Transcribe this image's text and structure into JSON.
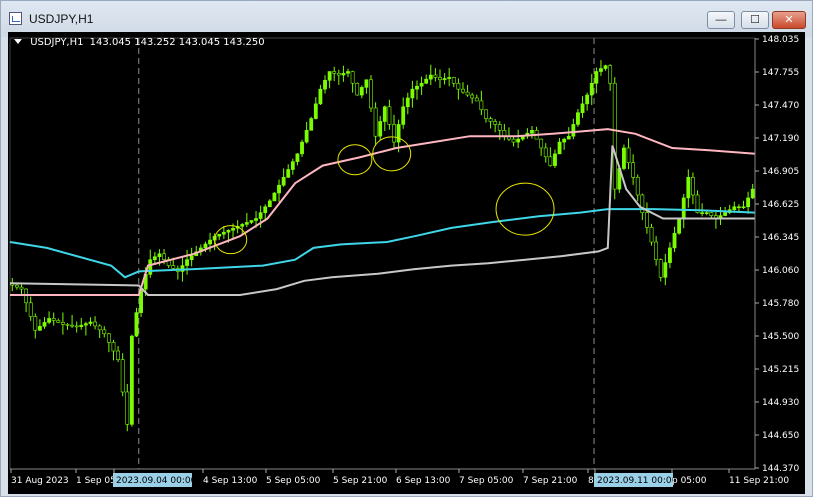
{
  "window": {
    "title": "USDJPY,H1",
    "buttons": {
      "minimize": "—",
      "maximize": "☐",
      "close": "✕"
    }
  },
  "chart_header": {
    "symbol": "USDJPY,H1",
    "ohlc": "143.045 143.252 143.045 143.250"
  },
  "colors": {
    "background": "#000000",
    "candle": "#7CFC00",
    "vwap_cyan": "#3fd6e8",
    "band_pink": "#ffb6c1",
    "band_gray": "#c8c8c8",
    "circles": "#e6e600",
    "period_separator": "#8c8c8c",
    "highlight_label": "#9ad0e8"
  },
  "chart_data": {
    "type": "candlestick",
    "symbol": "USDJPY",
    "timeframe": "H1",
    "y_ticks": [
      "148.035",
      "147.755",
      "147.470",
      "147.190",
      "146.905",
      "146.625",
      "146.345",
      "146.060",
      "145.780",
      "145.500",
      "145.215",
      "144.930",
      "144.650",
      "144.370"
    ],
    "x_labels": [
      "31 Aug 2023",
      "1 Sep 05",
      "2023.09.04 00:00",
      "4 Sep 13:00",
      "5 Sep 05:00",
      "5 Sep 21:00",
      "6 Sep 13:00",
      "7 Sep 05:00",
      "7 Sep 21:00",
      "8",
      "2023.09.11 00:00",
      "p 05:00",
      "11 Sep 21:00"
    ],
    "highlighted_x_labels": [
      "2023.09.04 00:00",
      "2023.09.11 00:00"
    ],
    "ylim": [
      144.37,
      148.035
    ],
    "price_path": [
      [
        0,
        145.95
      ],
      [
        3,
        145.9
      ],
      [
        6,
        145.55
      ],
      [
        9,
        145.65
      ],
      [
        12,
        145.6
      ],
      [
        15,
        145.58
      ],
      [
        18,
        145.62
      ],
      [
        21,
        145.52
      ],
      [
        24,
        145.3
      ],
      [
        26,
        144.75
      ],
      [
        27,
        145.5
      ],
      [
        29,
        145.9
      ],
      [
        31,
        146.15
      ],
      [
        33,
        146.2
      ],
      [
        35,
        146.1
      ],
      [
        37,
        146.05
      ],
      [
        39,
        146.15
      ],
      [
        42,
        146.25
      ],
      [
        45,
        146.35
      ],
      [
        48,
        146.4
      ],
      [
        51,
        146.45
      ],
      [
        54,
        146.5
      ],
      [
        57,
        146.65
      ],
      [
        60,
        146.85
      ],
      [
        63,
        147.05
      ],
      [
        66,
        147.35
      ],
      [
        68,
        147.6
      ],
      [
        70,
        147.75
      ],
      [
        72,
        147.72
      ],
      [
        74,
        147.75
      ],
      [
        76,
        147.55
      ],
      [
        78,
        147.68
      ],
      [
        80,
        147.2
      ],
      [
        82,
        147.45
      ],
      [
        84,
        147.15
      ],
      [
        86,
        147.45
      ],
      [
        88,
        147.6
      ],
      [
        90,
        147.65
      ],
      [
        92,
        147.72
      ],
      [
        94,
        147.68
      ],
      [
        96,
        147.7
      ],
      [
        98,
        147.6
      ],
      [
        100,
        147.55
      ],
      [
        102,
        147.5
      ],
      [
        104,
        147.35
      ],
      [
        106,
        147.3
      ],
      [
        108,
        147.2
      ],
      [
        110,
        147.15
      ],
      [
        112,
        147.2
      ],
      [
        114,
        147.25
      ],
      [
        116,
        147.1
      ],
      [
        118,
        146.95
      ],
      [
        120,
        147.15
      ],
      [
        122,
        147.2
      ],
      [
        124,
        147.4
      ],
      [
        126,
        147.55
      ],
      [
        128,
        147.75
      ],
      [
        130,
        147.8
      ],
      [
        131,
        147.65
      ],
      [
        132,
        146.75
      ],
      [
        134,
        147.1
      ],
      [
        136,
        146.85
      ],
      [
        138,
        146.55
      ],
      [
        140,
        146.3
      ],
      [
        142,
        146.0
      ],
      [
        144,
        146.25
      ],
      [
        146,
        146.5
      ],
      [
        148,
        146.85
      ],
      [
        150,
        146.55
      ],
      [
        152,
        146.55
      ],
      [
        154,
        146.5
      ],
      [
        156,
        146.55
      ],
      [
        158,
        146.6
      ],
      [
        160,
        146.6
      ],
      [
        162,
        146.75
      ]
    ],
    "series": [
      {
        "name": "",
        "color": "#3fd6e8",
        "values": [
          [
            0,
            146.3
          ],
          [
            8,
            146.25
          ],
          [
            22,
            146.1
          ],
          [
            25,
            146.0
          ],
          [
            28,
            146.05
          ],
          [
            40,
            146.07
          ],
          [
            55,
            146.1
          ],
          [
            62,
            146.15
          ],
          [
            66,
            146.25
          ],
          [
            72,
            146.28
          ],
          [
            82,
            146.3
          ],
          [
            88,
            146.35
          ],
          [
            96,
            146.42
          ],
          [
            105,
            146.47
          ],
          [
            115,
            146.52
          ],
          [
            124,
            146.55
          ],
          [
            130,
            146.58
          ],
          [
            140,
            146.58
          ],
          [
            150,
            146.57
          ],
          [
            162,
            146.55
          ]
        ]
      },
      {
        "name": "",
        "color": "#ffb6c1",
        "values": [
          [
            0,
            145.85
          ],
          [
            28,
            145.85
          ],
          [
            30,
            146.1
          ],
          [
            40,
            146.2
          ],
          [
            50,
            146.35
          ],
          [
            56,
            146.5
          ],
          [
            62,
            146.8
          ],
          [
            68,
            146.95
          ],
          [
            76,
            147.02
          ],
          [
            84,
            147.1
          ],
          [
            92,
            147.15
          ],
          [
            100,
            147.2
          ],
          [
            110,
            147.2
          ],
          [
            118,
            147.22
          ],
          [
            124,
            147.24
          ],
          [
            130,
            147.26
          ],
          [
            136,
            147.22
          ],
          [
            144,
            147.1
          ],
          [
            152,
            147.08
          ],
          [
            162,
            147.05
          ]
        ]
      },
      {
        "name": "",
        "color": "#c8c8c8",
        "values": [
          [
            0,
            145.95
          ],
          [
            28,
            145.93
          ],
          [
            30,
            145.85
          ],
          [
            40,
            145.85
          ],
          [
            50,
            145.85
          ],
          [
            58,
            145.9
          ],
          [
            64,
            145.97
          ],
          [
            70,
            146.0
          ],
          [
            80,
            146.03
          ],
          [
            88,
            146.07
          ],
          [
            96,
            146.1
          ],
          [
            104,
            146.12
          ],
          [
            112,
            146.15
          ],
          [
            120,
            146.18
          ],
          [
            128,
            146.22
          ],
          [
            130,
            146.25
          ],
          [
            131,
            147.12
          ],
          [
            134,
            146.75
          ],
          [
            137,
            146.6
          ],
          [
            142,
            146.5
          ],
          [
            150,
            146.5
          ],
          [
            162,
            146.5
          ]
        ]
      }
    ],
    "annotations": [
      {
        "type": "circle",
        "x": 48,
        "y": 146.32
      },
      {
        "type": "circle",
        "x": 75,
        "y": 147.0
      },
      {
        "type": "circle",
        "x": 83,
        "y": 147.05
      },
      {
        "type": "circle",
        "x": 112,
        "y": 146.58
      }
    ],
    "grid": false
  }
}
